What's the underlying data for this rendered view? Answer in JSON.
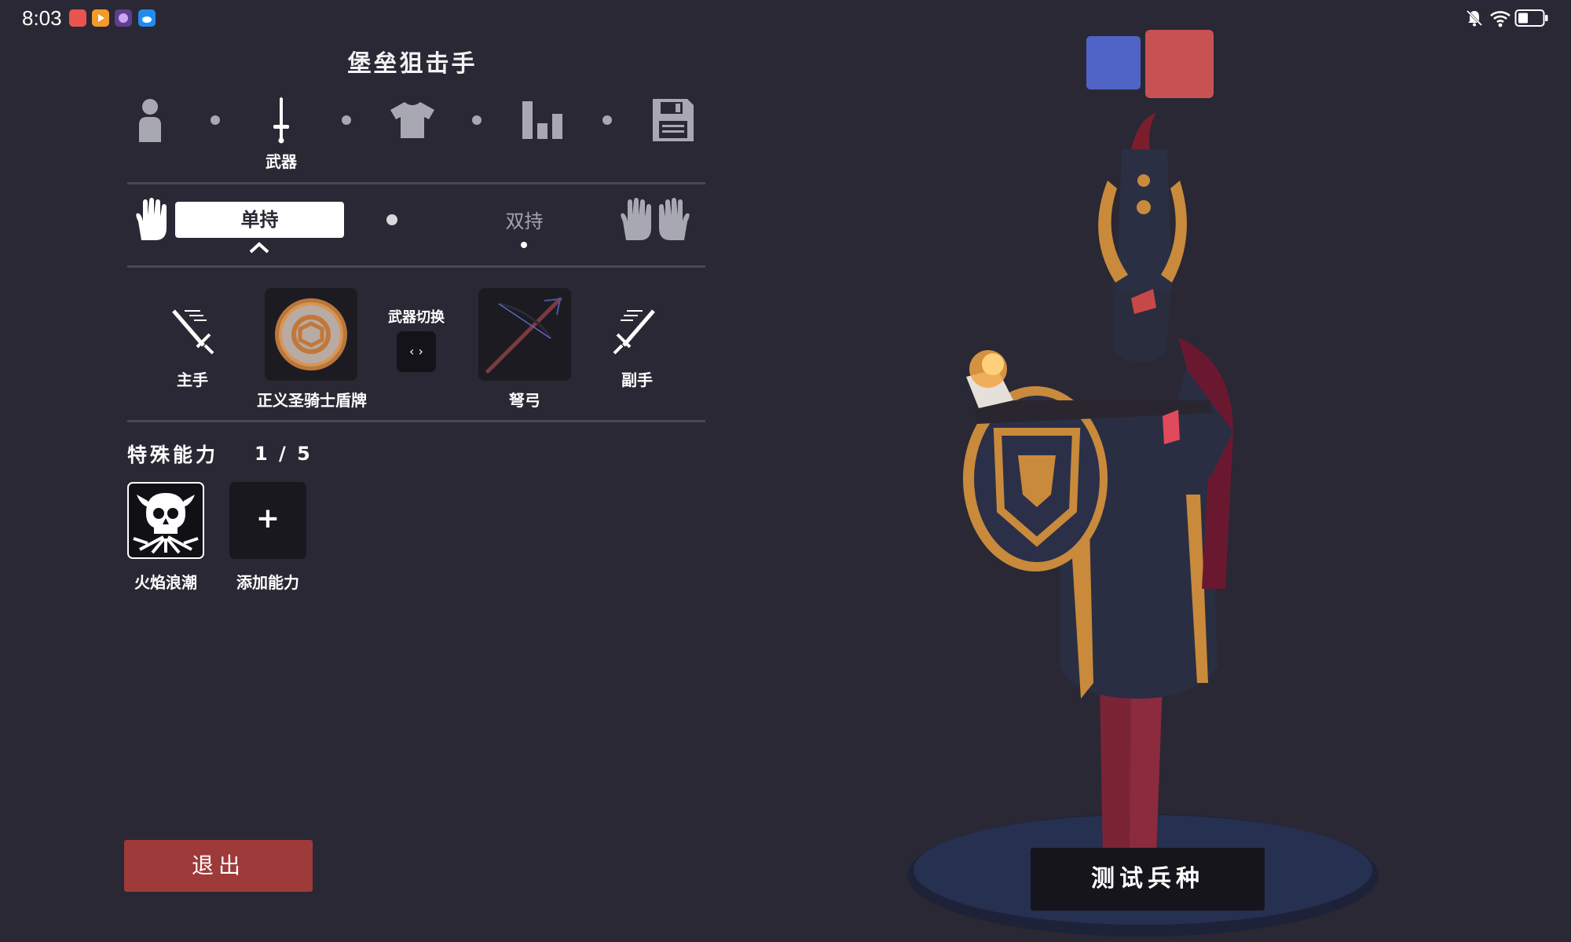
{
  "status_bar": {
    "time": "8:03",
    "app_icons": [
      "red-app-icon",
      "orange-play-icon",
      "purple-game-icon",
      "blue-cloud-icon"
    ],
    "indicators": [
      "bell-muted-icon",
      "wifi-icon",
      "battery-icon"
    ]
  },
  "unit_name": "堡垒狙击手",
  "steps": {
    "items": [
      "person-icon",
      "sword-icon",
      "shirt-icon",
      "stats-icon",
      "save-icon"
    ],
    "active_label": "武器"
  },
  "grip": {
    "single_label": "单持",
    "double_label": "双持"
  },
  "weapons": {
    "main_hand_label": "主手",
    "off_hand_label": "副手",
    "switch_label": "武器切换",
    "switch_button_text": "‹ ›",
    "main_weapon_name": "正义圣骑士盾牌",
    "off_weapon_name": "弩弓"
  },
  "abilities": {
    "title": "特殊能力",
    "count": "1 / 5",
    "items": [
      {
        "label": "火焰浪潮",
        "icon": "skull-horns-icon"
      },
      {
        "label": "添加能力",
        "icon": "+"
      }
    ]
  },
  "exit_label": "退出",
  "test_label": "测试兵种",
  "colors": {
    "background": "#2a2834",
    "team_blue": "#4f64c6",
    "team_red": "#c75254",
    "exit_button": "#9e3a3a"
  }
}
